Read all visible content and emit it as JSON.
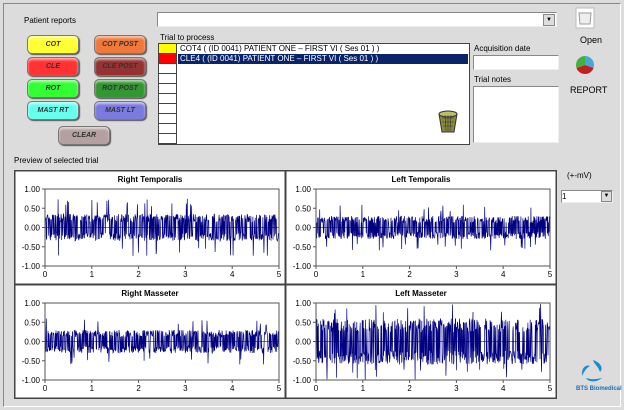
{
  "patient_reports": {
    "title": "Patient reports",
    "buttons": [
      {
        "label": "COT",
        "color": "#ffff33"
      },
      {
        "label": "COT  POST",
        "color": "#f07838"
      },
      {
        "label": "CLE",
        "color": "#ff3333"
      },
      {
        "label": "CLE POST",
        "color": "#963232"
      },
      {
        "label": "ROT",
        "color": "#33ff33"
      },
      {
        "label": "ROT POST",
        "color": "#329632"
      },
      {
        "label": "MAST RT",
        "color": "#66ffee"
      },
      {
        "label": "MAST LT",
        "color": "#7a7ae0"
      },
      {
        "label": "CLEAR",
        "color": "#b4a0a0"
      }
    ]
  },
  "top_select": {
    "value": ""
  },
  "trials": {
    "title": "Trial to process",
    "items": [
      {
        "label": "COT4 ( (ID 0041) PATIENT ONE – FIRST VI  ( Ses 01 ) )",
        "color": "#ffff00",
        "selected": false
      },
      {
        "label": "CLE4 ( (ID 0041) PATIENT ONE – FIRST VI  ( Ses 01 ) )",
        "color": "#ff0000",
        "selected": true
      }
    ]
  },
  "acquisition_date": {
    "label": "Acquisition date",
    "value": ""
  },
  "trial_notes": {
    "label": "Trial notes",
    "value": ""
  },
  "open_label": "Open",
  "report_label": "REPORT",
  "preview_title": "Preview of selected trial",
  "scale": {
    "label": "(+-mV)",
    "value": "1"
  },
  "logo_text": "BTS Biomedical",
  "chart_data": [
    {
      "type": "line",
      "title": "Right Temporalis",
      "ylim": [
        -1,
        1
      ],
      "xlim": [
        0,
        5
      ],
      "yticks": [
        "1.00",
        "0.50",
        "0.00",
        "-0.50",
        "-1.00"
      ],
      "xticks": [
        "0",
        "1",
        "2",
        "3",
        "4",
        "5"
      ],
      "approx_amplitude": 0.35,
      "peak": 0.75,
      "color": "#000080"
    },
    {
      "type": "line",
      "title": "Left Temporalis",
      "ylim": [
        -1,
        1
      ],
      "xlim": [
        0,
        5
      ],
      "yticks": [
        "1.00",
        "0.50",
        "0.00",
        "-0.50",
        "-1.00"
      ],
      "xticks": [
        "0",
        "1",
        "2",
        "3",
        "4",
        "5"
      ],
      "approx_amplitude": 0.3,
      "peak": 0.6,
      "color": "#000080"
    },
    {
      "type": "line",
      "title": "Right Masseter",
      "ylim": [
        -1,
        1
      ],
      "xlim": [
        0,
        5
      ],
      "yticks": [
        "1.00",
        "0.50",
        "0.00",
        "-0.50",
        "-1.00"
      ],
      "xticks": [
        "0",
        "1",
        "2",
        "3",
        "4",
        "5"
      ],
      "approx_amplitude": 0.3,
      "peak": 0.6,
      "color": "#000080"
    },
    {
      "type": "line",
      "title": "Left Masseter",
      "ylim": [
        -1,
        1
      ],
      "xlim": [
        0,
        5
      ],
      "yticks": [
        "1.00",
        "0.50",
        "0.00",
        "-0.50",
        "-1.00"
      ],
      "xticks": [
        "0",
        "1",
        "2",
        "3",
        "4",
        "5"
      ],
      "approx_amplitude": 0.6,
      "peak": 1.0,
      "color": "#000080"
    }
  ]
}
